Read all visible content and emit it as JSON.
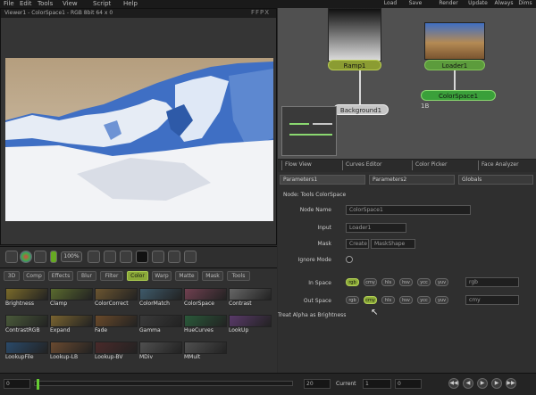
{
  "menubar": {
    "items": [
      "File",
      "Edit",
      "Tools",
      "View",
      "Script",
      "Help"
    ],
    "right_buttons": [
      "Load",
      "Save",
      "Render",
      "Update",
      "Always",
      "Dims"
    ]
  },
  "viewer": {
    "title": "Viewer1 - ColorSpace1 - RGB 8bit 64 x 0",
    "close_label": "FFPX"
  },
  "viewer_toolbar": {
    "fit_label": "100%",
    "icons": [
      "b-icon",
      "color-wheel-icon",
      "lock-icon",
      "crop-icon",
      "grid-icon",
      "split-icon",
      "checker-icon",
      "roi-icon",
      "lut-icon",
      "sub-view-icon"
    ]
  },
  "toolbin": {
    "tabs": [
      "3D",
      "Comp",
      "Effects",
      "Blur",
      "Filter",
      "Color",
      "Warp",
      "Matte",
      "Mask",
      "Tools"
    ],
    "active_tab": "Color",
    "tools": [
      {
        "label": "Brightness",
        "color": "#7a6a2a"
      },
      {
        "label": "Clamp",
        "color": "#5a6a2e"
      },
      {
        "label": "ColorCorrect",
        "color": "#6b5530"
      },
      {
        "label": "ColorMatch",
        "color": "#3e5a6a"
      },
      {
        "label": "ColorSpace",
        "color": "#704050"
      },
      {
        "label": "Contrast",
        "color": "#666"
      },
      {
        "label": "ContrastRGB",
        "color": "#4a5a3a"
      },
      {
        "label": "Expand",
        "color": "#7a6430"
      },
      {
        "label": "Fade",
        "color": "#6a4a2a"
      },
      {
        "label": "Gamma",
        "color": "#3a3a3a"
      },
      {
        "label": "HueCurves",
        "color": "#2a5a3a"
      },
      {
        "label": "LookUp",
        "color": "#5a3a6a"
      },
      {
        "label": "LookupFile",
        "color": "#2a4a6a"
      },
      {
        "label": "Lookup-LB",
        "color": "#6a4a30"
      },
      {
        "label": "Lookup-BV",
        "color": "#4a2a2a"
      },
      {
        "label": "MDiv",
        "color": "#505050"
      },
      {
        "label": "MMult",
        "color": "#505050"
      }
    ]
  },
  "flow": {
    "nodes": {
      "ramp": "Ramp1",
      "loader": "Loader1",
      "colorspace": "ColorSpace1",
      "background": "Background1",
      "colorspace_sub": "1B"
    }
  },
  "view_tabs": [
    "Flow View",
    "Curves Editor",
    "Color Picker",
    "Face Analyzer"
  ],
  "panel": {
    "tabs": [
      "Parameters1",
      "Parameters2",
      "Globals"
    ],
    "heading": "Node: Tools ColorSpace",
    "fields": {
      "node_name_label": "Node Name",
      "node_name": "ColorSpace1",
      "input_label": "Input",
      "input": "Loader1",
      "mask_label": "Mask",
      "mask_value": "Create",
      "mask_shape": "MaskShape",
      "ignore_label": "Ignore Mode"
    },
    "in_space": {
      "label": "In Space",
      "options": [
        "rgb",
        "cmy",
        "hls",
        "hsv",
        "ycc",
        "yuv"
      ],
      "selected": "rgb",
      "extra": "rgb"
    },
    "out_space": {
      "label": "Out Space",
      "options": [
        "rgb",
        "cmy",
        "hls",
        "hsv",
        "ycc",
        "yuv"
      ],
      "selected": "cmy",
      "extra": "cmy"
    },
    "alpha_label": "Treat Alpha as Brightness"
  },
  "timeline": {
    "fields": [
      "0",
      "20",
      "Current",
      "1",
      "0"
    ],
    "buttons": [
      "rewind",
      "prev",
      "play",
      "next",
      "end"
    ]
  },
  "colors": {
    "accent_green": "#8aa838",
    "node_gray": "#c6c6c6",
    "image_sky": "#c7b59a",
    "snow_blue": "#3f6fc4"
  }
}
